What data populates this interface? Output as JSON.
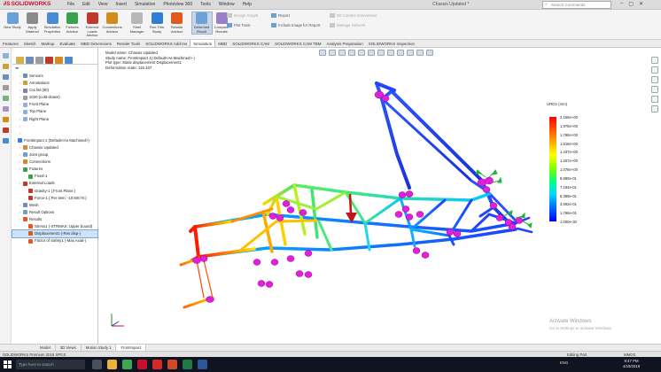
{
  "app": {
    "brand": "SOLIDWORKS",
    "menus": [
      "File",
      "Edit",
      "View",
      "Insert",
      "Simulation",
      "Photoview 360",
      "Tools",
      "Window",
      "Help"
    ],
    "doc_title": "Chassis Updated *",
    "search_placeholder": "Search Commands",
    "win_controls": [
      "–",
      "▢",
      "✕"
    ]
  },
  "ribbon": {
    "buttons": [
      {
        "label": "New Study",
        "icon": "new-study-icon",
        "color": "#6a9fd8"
      },
      {
        "label": "Apply Material",
        "icon": "apply-material-icon",
        "color": "#8a8a8a"
      },
      {
        "label": "Simulation Properties",
        "icon": "properties-icon",
        "color": "#4a8bd4"
      },
      {
        "label": "Fixtures Advisor",
        "icon": "fixtures-icon",
        "color": "#37a34a"
      },
      {
        "label": "External Loads Advisor",
        "icon": "loads-icon",
        "color": "#c0392b"
      },
      {
        "label": "Connections Advisor",
        "icon": "connections-icon",
        "color": "#d38a1e"
      },
      {
        "label": "Shell Manager",
        "icon": "shell-icon",
        "color": "#b7b7b7"
      },
      {
        "label": "Run This Study",
        "icon": "run-icon",
        "color": "#2f7ed8"
      },
      {
        "label": "Results Advisor",
        "icon": "results-icon",
        "color": "#e05a1d"
      },
      {
        "label": "Deformed Result",
        "icon": "deformed-icon",
        "color": "#6ba3d9"
      },
      {
        "label": "Compare Results",
        "icon": "compare-icon",
        "color": "#9a7fc6"
      }
    ],
    "small_items": [
      {
        "label": "Design Insight",
        "dim": true
      },
      {
        "label": "Plot Tools",
        "dim": false
      },
      {
        "label": "Report",
        "dim": false
      },
      {
        "label": "Include Image for Report",
        "dim": false
      },
      {
        "label": "3D Content Intervention",
        "dim": true
      },
      {
        "label": "Manage Network",
        "dim": true
      }
    ]
  },
  "tabs": [
    "Features",
    "Sketch",
    "Markup",
    "Evaluate",
    "MBD Dimensions",
    "Render Tools",
    "SOLIDWORKS Add-Ins",
    "Simulation",
    "MBD",
    "SOLIDWORKS CAM",
    "SOLIDWORKS CAM TBM",
    "Analysis Preparation",
    "SOLIDWORKS Inspection"
  ],
  "active_tab": 7,
  "tree": [
    {
      "label": "Sensors",
      "indent": 1,
      "color": "#6b8fb8"
    },
    {
      "label": "Annotations",
      "indent": 1,
      "color": "#c9a23a"
    },
    {
      "label": "Cut list (80)",
      "indent": 1,
      "color": "#8c7bb0"
    },
    {
      "label": "1020 (cold-drawn)",
      "indent": 1,
      "color": "#9c9c9c"
    },
    {
      "label": "Front Plane",
      "indent": 1,
      "color": "#8fb1d6"
    },
    {
      "label": "Top Plane",
      "indent": 1,
      "color": "#8fb1d6"
    },
    {
      "label": "Right Plane",
      "indent": 1,
      "color": "#8fb1d6"
    },
    {
      "label": "",
      "indent": 1,
      "color": "#ffffff"
    },
    {
      "label": "",
      "indent": 1,
      "color": "#ffffff"
    },
    {
      "label": "Frontimpact 1 (Default<As Machined>)",
      "indent": 0,
      "color": "#3a7bd5"
    },
    {
      "label": "Chassis Updated",
      "indent": 1,
      "color": "#d08a3a"
    },
    {
      "label": "Joint group",
      "indent": 1,
      "color": "#6a9fd8"
    },
    {
      "label": "Connections",
      "indent": 1,
      "color": "#d38a1e"
    },
    {
      "label": "Fixtures",
      "indent": 1,
      "color": "#37a34a"
    },
    {
      "label": "Fixed-1",
      "indent": 2,
      "color": "#37a34a"
    },
    {
      "label": "External Loads",
      "indent": 1,
      "color": "#c0392b"
    },
    {
      "label": "Gravity-1 (:Front Plane:)",
      "indent": 2,
      "color": "#c0392b"
    },
    {
      "label": "Force-1 (:Per item: -10,500 N:)",
      "indent": 2,
      "color": "#c0392b"
    },
    {
      "label": "Mesh",
      "indent": 1,
      "color": "#6b8fb8"
    },
    {
      "label": "Result Options",
      "indent": 1,
      "color": "#7b9cc4"
    },
    {
      "label": "Results",
      "indent": 1,
      "color": "#e05a1d"
    },
    {
      "label": "Stress1 (-STRMAX: Upper bound)",
      "indent": 2,
      "color": "#e05a1d"
    },
    {
      "label": "Displacement1 (-Res disp-)",
      "indent": 2,
      "color": "#e05a1d",
      "selected": true
    },
    {
      "label": "Factor of Safety1 (-Max Axial-)",
      "indent": 2,
      "color": "#e05a1d"
    }
  ],
  "info": {
    "line1": "Model name: Chassis Updated",
    "line2": "Study name: Frontimpact 1(-Default<As Machined>-)",
    "line3": "Plot type: Static displacement Displacement1",
    "line4": "Deformation scale: 115.167"
  },
  "legend": {
    "title": "URES (mm)",
    "values": [
      "2.155e+00",
      "1.975e+00",
      "1.796e+00",
      "1.616e+00",
      "1.437e+00",
      "1.257e+00",
      "1.078e+00",
      "8.980e-01",
      "7.184e-01",
      "5.388e-01",
      "3.592e-01",
      "1.796e-01",
      "1.000e-30"
    ]
  },
  "watermark": {
    "line1": "Activate Windows",
    "line2": "Go to Settings to activate Windows."
  },
  "bottom_tabs": [
    "Model",
    "3D Views",
    "Motion Study 1",
    "Frontimpact"
  ],
  "active_bottom_tab": 3,
  "status": {
    "left": "SOLIDWORKS Premium 2018 SP0.0",
    "right": "Editing Part",
    "units": "MMGS"
  },
  "taskbar": {
    "search_placeholder": "Type here to search",
    "apps": [
      {
        "name": "task-view-icon",
        "color": "#4a4f5c"
      },
      {
        "name": "file-explorer-icon",
        "color": "#e8b33a"
      },
      {
        "name": "chrome-icon",
        "color": "#3fa651"
      },
      {
        "name": "acrobat-icon",
        "color": "#c8102e"
      },
      {
        "name": "solidworks-icon",
        "color": "#d62828"
      },
      {
        "name": "powerpoint-icon",
        "color": "#d2492a"
      },
      {
        "name": "excel-icon",
        "color": "#1f7a45"
      },
      {
        "name": "word-icon",
        "color": "#2b5797"
      }
    ],
    "tray": "ENG",
    "time": "9:47 PM",
    "date": "4/19/2019"
  }
}
